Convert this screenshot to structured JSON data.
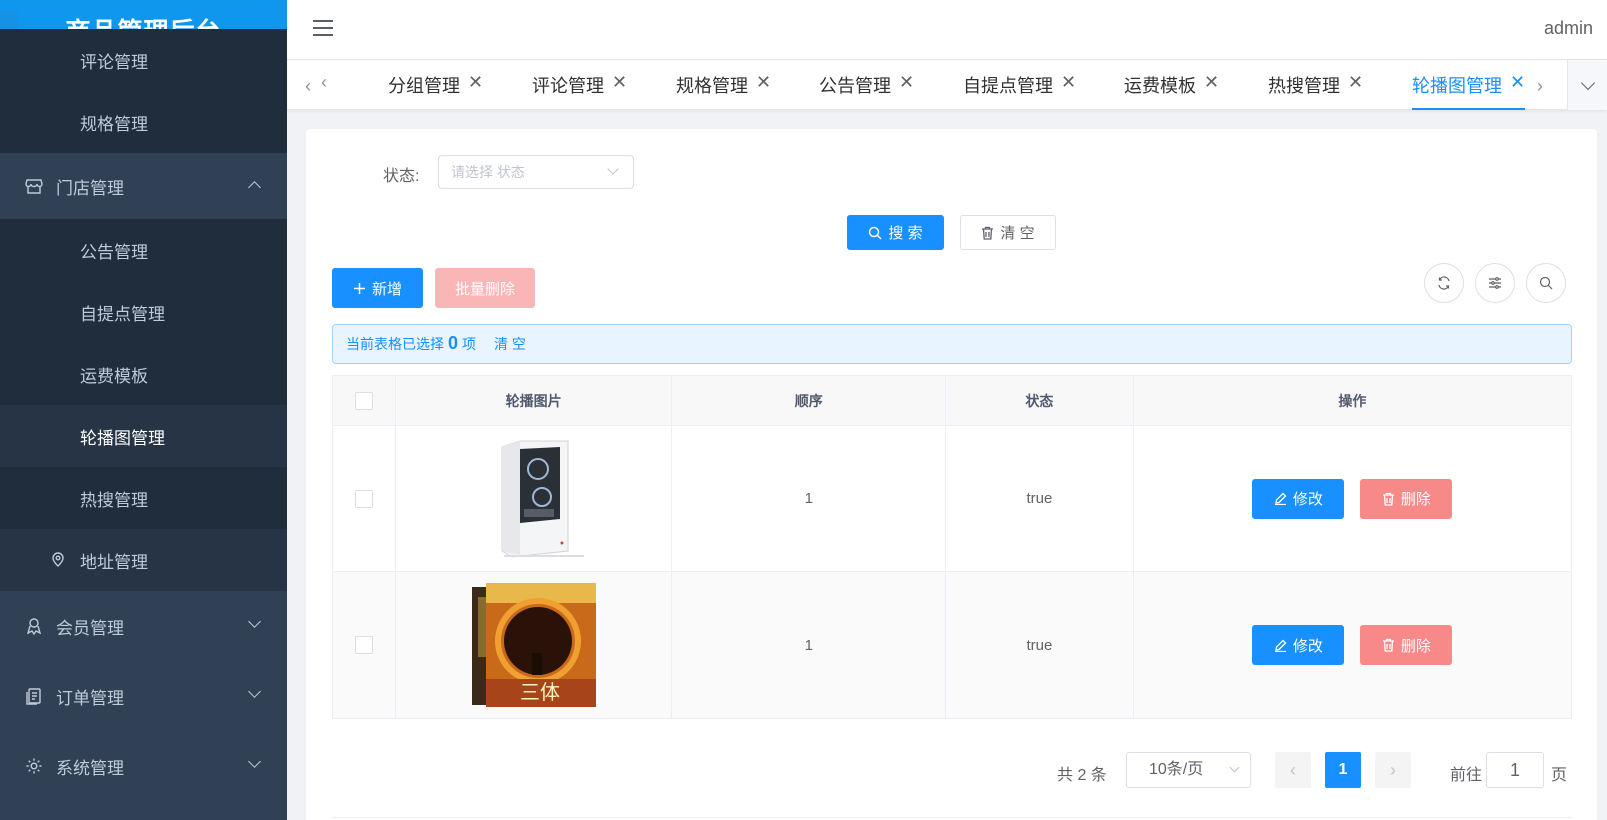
{
  "app": {
    "title": "商品管理后台",
    "user": "admin"
  },
  "sidebar": {
    "items": [
      {
        "label": "评论管理",
        "type": "sub"
      },
      {
        "label": "规格管理",
        "type": "sub"
      },
      {
        "label": "门店管理",
        "type": "group",
        "icon": "store-icon",
        "expanded": true
      },
      {
        "label": "公告管理",
        "type": "sub"
      },
      {
        "label": "自提点管理",
        "type": "sub"
      },
      {
        "label": "运费模板",
        "type": "sub"
      },
      {
        "label": "轮播图管理",
        "type": "sub",
        "active": true
      },
      {
        "label": "热搜管理",
        "type": "sub"
      },
      {
        "label": "地址管理",
        "type": "leaf",
        "icon": "location-icon"
      },
      {
        "label": "会员管理",
        "type": "group",
        "icon": "member-icon"
      },
      {
        "label": "订单管理",
        "type": "group",
        "icon": "order-icon"
      },
      {
        "label": "系统管理",
        "type": "group",
        "icon": "gear-icon"
      }
    ]
  },
  "tabs": [
    {
      "label": "分组管理"
    },
    {
      "label": "评论管理"
    },
    {
      "label": "规格管理"
    },
    {
      "label": "公告管理"
    },
    {
      "label": "自提点管理"
    },
    {
      "label": "运费模板"
    },
    {
      "label": "热搜管理"
    },
    {
      "label": "轮播图管理",
      "active": true
    }
  ],
  "filter": {
    "label": "状态:",
    "placeholder": "请选择 状态"
  },
  "buttons": {
    "search": "搜 索",
    "clear": "清 空",
    "add": "新增",
    "batch_delete": "批量删除",
    "edit": "修改",
    "delete": "删除"
  },
  "selection": {
    "prefix": "当前表格已选择",
    "count": "0",
    "suffix": "项",
    "clear": "清 空"
  },
  "table": {
    "headers": [
      "轮播图片",
      "顺序",
      "状态",
      "操作"
    ],
    "rows": [
      {
        "image": "pc-case-image",
        "order": "1",
        "status": "true"
      },
      {
        "image": "book-cover-image",
        "order": "1",
        "status": "true"
      }
    ]
  },
  "pagination": {
    "total": "共 2 条",
    "page_size": "10条/页",
    "current": "1",
    "goto_label": "前往",
    "goto_value": "1",
    "page_label": "页"
  },
  "colors": {
    "primary": "#1890ff",
    "sidebar": "#304156",
    "logo_bg": "#0e97ec",
    "danger": "#f78989"
  }
}
